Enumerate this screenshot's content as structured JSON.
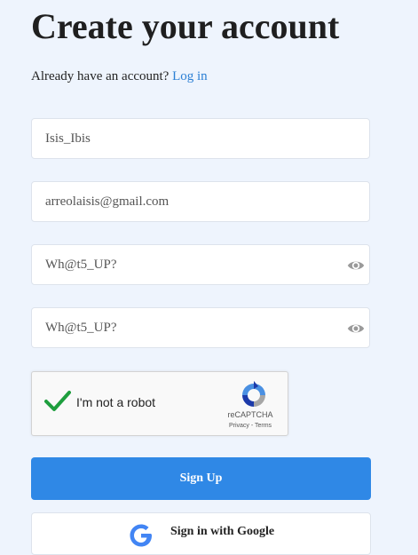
{
  "header": {
    "title": "Create your account",
    "login_prompt": "Already have an account?",
    "login_link": "Log in"
  },
  "form": {
    "username_value": "Isis_Ibis",
    "email_value": "arreolaisis@gmail.com",
    "password_value": "Wh@t5_UP?",
    "confirm_password_value": "Wh@t5_UP?"
  },
  "captcha": {
    "label": "I'm not a robot",
    "brand": "reCAPTCHA",
    "privacy": "Privacy",
    "separator": " - ",
    "terms": "Terms",
    "checked": true
  },
  "actions": {
    "signup_label": "Sign Up",
    "google_label": "Sign in with Google"
  },
  "icons": {
    "password_toggle": "eye-icon",
    "captcha_check": "checkmark-icon",
    "captcha_logo": "recaptcha-logo-icon",
    "google_logo": "google-g-icon"
  },
  "colors": {
    "background": "#eef4fd",
    "accent": "#2f88e6",
    "link": "#2b7fd4",
    "check": "#1e9e3e"
  }
}
